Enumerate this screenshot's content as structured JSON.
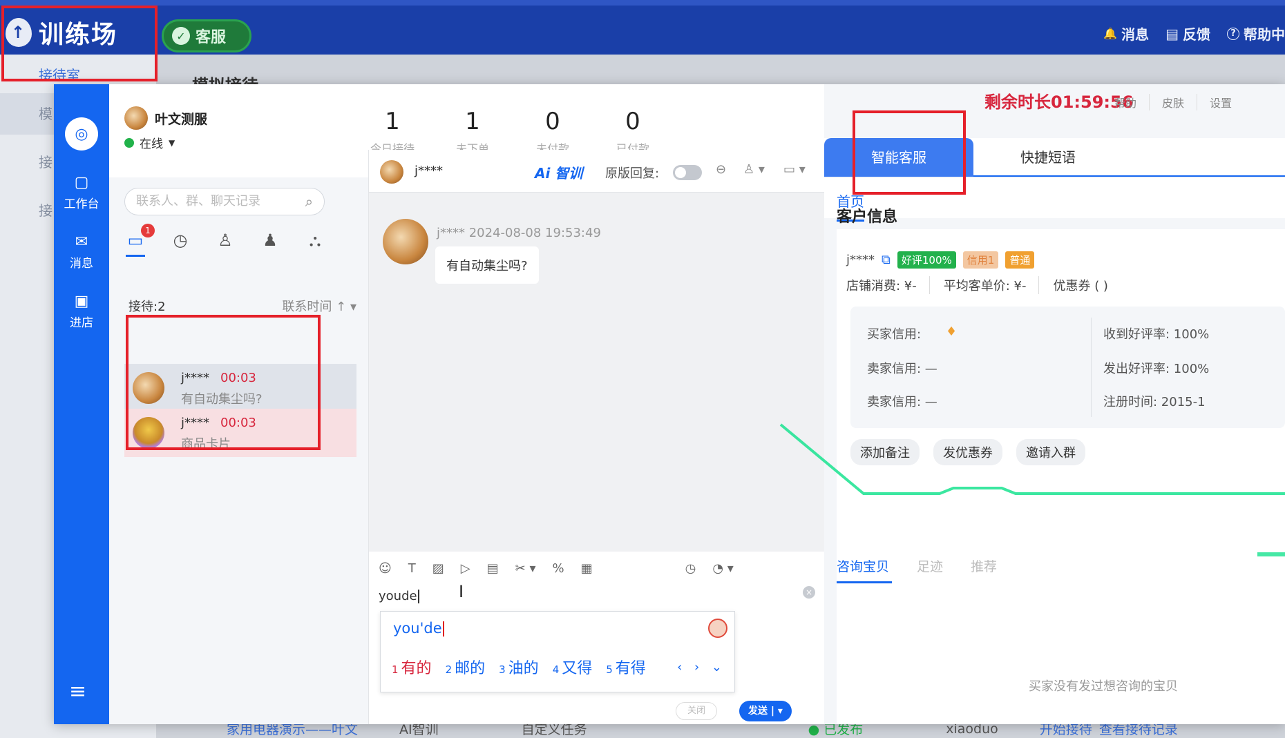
{
  "topbar": {
    "brand": "训练场",
    "badge": "客服",
    "links": [
      {
        "icon": "bell-icon",
        "glyph": "🔔",
        "label": "消息"
      },
      {
        "icon": "feedback-icon",
        "glyph": "▤",
        "label": "反馈"
      },
      {
        "icon": "help-icon",
        "glyph": "?",
        "label": "帮助中"
      }
    ]
  },
  "background": {
    "sidebar": [
      "接待室",
      "模",
      "接",
      "接"
    ],
    "heading": "模拟接待",
    "bottom_row": [
      "家用电器演示——叶文",
      "AI智训",
      "自定义任务",
      "● 已发布",
      "xiaoduo",
      "开始接待",
      "查看接待记录"
    ]
  },
  "rail": {
    "items": [
      {
        "icon": "workbench-icon",
        "glyph": "▢",
        "label": "工作台"
      },
      {
        "icon": "message-icon",
        "glyph": "✉",
        "label": "消息"
      },
      {
        "icon": "store-icon",
        "glyph": "▣",
        "label": "进店"
      }
    ]
  },
  "profile": {
    "name": "叶文测服",
    "status": "在线"
  },
  "stats": [
    {
      "value": "1",
      "label": "今日接待"
    },
    {
      "value": "1",
      "label": "未下单"
    },
    {
      "value": "0",
      "label": "未付款"
    },
    {
      "value": "0",
      "label": "已付款"
    }
  ],
  "search": {
    "placeholder": "联系人、群、聊天记录"
  },
  "list_tabs_badge": "1",
  "reception": {
    "count": "接待:2",
    "sort": "联系时间"
  },
  "conversations": [
    {
      "name": "j****",
      "time": "00:03",
      "preview": "有自动集尘吗?"
    },
    {
      "name": "j****",
      "time": "00:03",
      "preview": "商品卡片"
    }
  ],
  "chat": {
    "name": "j****",
    "ai_label": "Ai 智训",
    "orig_reply": "原版回复:",
    "msg_meta": "j****  2024-08-08 19:53:49",
    "msg_text": "有自动集尘吗?",
    "input": "youde",
    "ime_pinyin": "you'de",
    "candidates": [
      {
        "n": "1",
        "w": "有的"
      },
      {
        "n": "2",
        "w": "邮的"
      },
      {
        "n": "3",
        "w": "油的"
      },
      {
        "n": "4",
        "w": "又得"
      },
      {
        "n": "5",
        "w": "有得"
      }
    ],
    "close_btn": "关闭",
    "send_btn": "发送 | ▾"
  },
  "right": {
    "timer": "剩余时长01:59:56",
    "links": [
      "帮助",
      "皮肤",
      "设置"
    ],
    "tabs": [
      "智能客服",
      "快捷短语"
    ],
    "subtab": "首页",
    "section_title": "客户信息",
    "cust_name": "j****",
    "tags": [
      "好评100%",
      "信用1",
      "普通"
    ],
    "spend": [
      "店铺消费: ¥-",
      "平均客单价: ¥-",
      "优惠券 ( )"
    ],
    "credit": {
      "buyer": "买家信用:",
      "seller1": "卖家信用:  —",
      "seller2": "卖家信用:  —",
      "recv_rate": "收到好评率:  100%",
      "send_rate": "发出好评率:  100%",
      "reg": "注册时间:     2015-1"
    },
    "actions": [
      "添加备注",
      "发优惠券",
      "邀请入群"
    ],
    "bottom_tabs": [
      "咨询宝贝",
      "足迹",
      "推荐"
    ],
    "empty": "买家没有发过想咨询的宝贝"
  },
  "colors": {
    "primary": "#1466f0",
    "topbar": "#1a3fa8",
    "alert": "#d7263d",
    "highlight": "#e5202a"
  }
}
